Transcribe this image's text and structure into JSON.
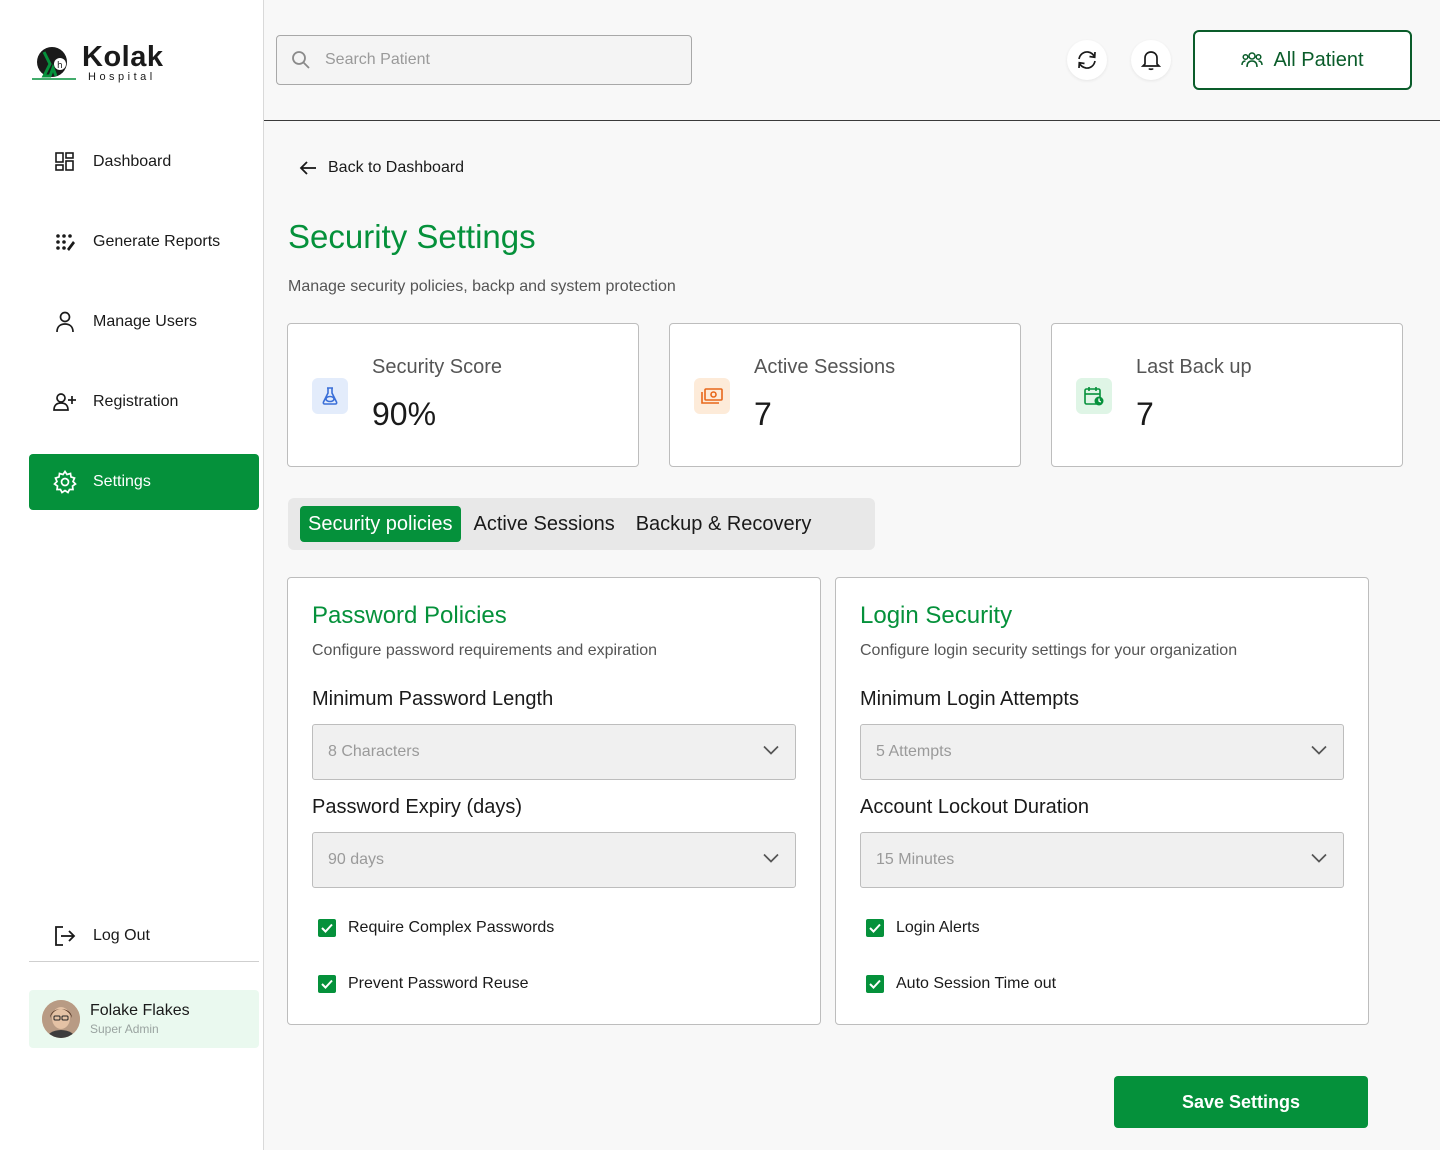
{
  "brand": {
    "name": "Kolak",
    "sub": "Hospital",
    "color": "#05913b"
  },
  "sidebar": {
    "items": [
      {
        "label": "Dashboard",
        "icon": "dashboard-icon"
      },
      {
        "label": "Generate Reports",
        "icon": "reports-icon"
      },
      {
        "label": "Manage Users",
        "icon": "user-icon"
      },
      {
        "label": "Registration",
        "icon": "user-add-icon"
      },
      {
        "label": "Settings",
        "icon": "gear-icon",
        "active": true
      }
    ],
    "logout": "Log Out",
    "user": {
      "name": "Folake Flakes",
      "role": "Super Admin"
    }
  },
  "topbar": {
    "search_placeholder": "Search Patient",
    "all_patient_label": "All Patient"
  },
  "page": {
    "back_label": "Back to Dashboard",
    "title": "Security Settings",
    "subtitle": "Manage security policies, backp and system protection"
  },
  "stats": [
    {
      "label": "Security Score",
      "value": "90%",
      "icon": "flask-icon",
      "icon_bg": "#e3ecfb",
      "icon_color": "#3a6fd8"
    },
    {
      "label": "Active Sessions",
      "value": "7",
      "icon": "money-icon",
      "icon_bg": "#fdebd9",
      "icon_color": "#e8671a"
    },
    {
      "label": "Last Back up",
      "value": "7",
      "icon": "calendar-clock-icon",
      "icon_bg": "#dff5e6",
      "icon_color": "#05913b"
    }
  ],
  "tabs": [
    {
      "label": "Security policies",
      "active": true
    },
    {
      "label": "Active Sessions"
    },
    {
      "label": "Backup & Recovery"
    }
  ],
  "password_panel": {
    "title": "Password Policies",
    "subtitle": "Configure password requirements and expiration",
    "field1_label": "Minimum Password Length",
    "field1_value": "8 Characters",
    "field2_label": "Password Expiry (days)",
    "field2_value": "90 days",
    "check1": "Require Complex Passwords",
    "check2": "Prevent Password Reuse"
  },
  "login_panel": {
    "title": "Login Security",
    "subtitle": "Configure login security settings for your organization",
    "field1_label": "Minimum Login Attempts",
    "field1_value": "5 Attempts",
    "field2_label": "Account Lockout Duration",
    "field2_value": "15 Minutes",
    "check1": "Login Alerts",
    "check2": "Auto Session Time out"
  },
  "save_label": "Save Settings"
}
